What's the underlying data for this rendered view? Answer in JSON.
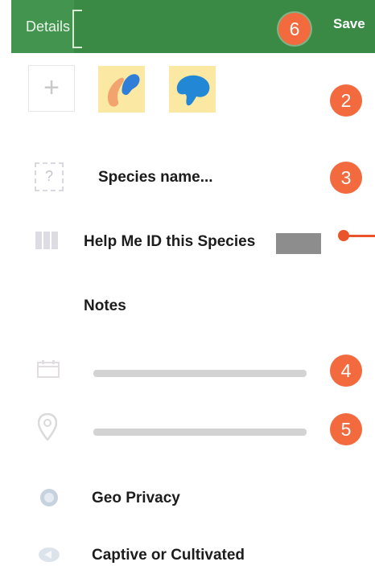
{
  "header": {
    "title": "Details",
    "save_label": "Save",
    "callout": "6"
  },
  "photos": {
    "add_label": "+",
    "callout": "2"
  },
  "species": {
    "icon_text": "?",
    "placeholder": "Species name...",
    "callout": "3"
  },
  "help_id": {
    "label": "Help Me ID this Species"
  },
  "notes": {
    "label": "Notes"
  },
  "date": {
    "callout": "4"
  },
  "location": {
    "callout": "5"
  },
  "geo_privacy": {
    "label": "Geo Privacy"
  },
  "captive": {
    "label": "Captive or Cultivated"
  },
  "colors": {
    "header_green": "#3a8a46",
    "callout_orange": "#f26a3e",
    "thumb_background": "#fbe9a3"
  },
  "icons": [
    "plus-icon",
    "question-icon",
    "id-help-icon",
    "calendar-icon",
    "location-pin-icon",
    "globe-icon",
    "captive-icon"
  ]
}
